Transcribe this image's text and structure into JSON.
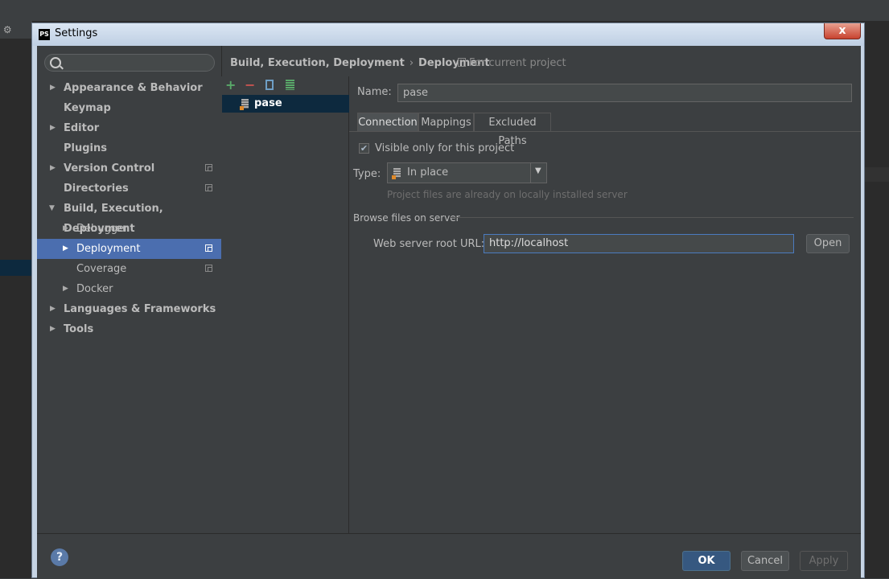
{
  "window": {
    "title": "Settings",
    "close_label": "x"
  },
  "background": {
    "toolbar_glyph": "⚙"
  },
  "search": {
    "placeholder": ""
  },
  "sidebar": {
    "items": [
      {
        "label": "Appearance & Behavior"
      },
      {
        "label": "Keymap"
      },
      {
        "label": "Editor"
      },
      {
        "label": "Plugins"
      },
      {
        "label": "Version Control"
      },
      {
        "label": "Directories"
      },
      {
        "label": "Build, Execution, Deployment"
      },
      {
        "label": "Debugger"
      },
      {
        "label": "Deployment"
      },
      {
        "label": "Coverage"
      },
      {
        "label": "Docker"
      },
      {
        "label": "Languages & Frameworks"
      },
      {
        "label": "Tools"
      }
    ]
  },
  "breadcrumb": {
    "parent": "Build, Execution, Deployment",
    "separator": "›",
    "current": "Deployment",
    "note": "For current project"
  },
  "toolbar": {
    "add": "+",
    "remove": "−"
  },
  "servers": [
    {
      "name": "pase"
    }
  ],
  "form": {
    "name_label": "Name:",
    "name_value": "pase",
    "tabs": [
      {
        "label": "Connection"
      },
      {
        "label": "Mappings"
      },
      {
        "label": "Excluded Paths"
      }
    ],
    "visible_checked": true,
    "visible_label": "Visible only for this project",
    "type_label": "Type:",
    "type_value": "In place",
    "type_hint": "Project files are already on locally installed server",
    "browse_section": "Browse files on server",
    "url_label": "Web server root URL:",
    "url_value": "http://localhost",
    "open_label": "Open"
  },
  "footer": {
    "help": "?",
    "ok": "OK",
    "cancel": "Cancel",
    "apply": "Apply"
  },
  "colors": {
    "accent": "#4b6eaf",
    "ok_button": "#365880",
    "panel": "#3c3f41",
    "add_icon": "#59a869",
    "remove_icon": "#c75450"
  }
}
